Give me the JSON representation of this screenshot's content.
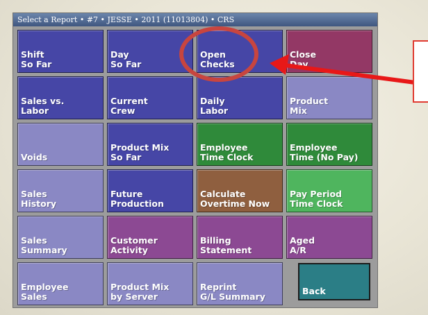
{
  "window": {
    "title": "Select a Report • #7 • JESSE • 2011 (11013804) • CRS"
  },
  "tiles": [
    {
      "line1": "Shift",
      "line2": "So Far",
      "color": "#4646a6"
    },
    {
      "line1": "Day",
      "line2": "So Far",
      "color": "#4646a6"
    },
    {
      "line1": "Open",
      "line2": "Checks",
      "color": "#4646a6"
    },
    {
      "line1": "Close",
      "line2": "Day",
      "color": "#933865"
    },
    {
      "line1": "Sales vs.",
      "line2": "Labor",
      "color": "#4646a6"
    },
    {
      "line1": "Current",
      "line2": "Crew",
      "color": "#4646a6"
    },
    {
      "line1": "Daily",
      "line2": "Labor",
      "color": "#4646a6"
    },
    {
      "line1": "Product",
      "line2": "Mix",
      "color": "#8a88c4"
    },
    {
      "line1": "",
      "line2": "Voids",
      "color": "#8a88c4"
    },
    {
      "line1": "Product Mix",
      "line2": "So Far",
      "color": "#4646a6"
    },
    {
      "line1": "Employee",
      "line2": "Time Clock",
      "color": "#2f8a3a"
    },
    {
      "line1": "Employee",
      "line2": "Time (No Pay)",
      "color": "#2f8a3a"
    },
    {
      "line1": "Sales",
      "line2": "History",
      "color": "#8a88c4"
    },
    {
      "line1": "Future",
      "line2": "Production",
      "color": "#4646a6"
    },
    {
      "line1": "Calculate",
      "line2": "Overtime Now",
      "color": "#8f5f3f"
    },
    {
      "line1": "Pay Period",
      "line2": "Time Clock",
      "color": "#4fb55e"
    },
    {
      "line1": "Sales",
      "line2": "Summary",
      "color": "#8a88c4"
    },
    {
      "line1": "Customer",
      "line2": "Activity",
      "color": "#8c4993"
    },
    {
      "line1": "Billing",
      "line2": "Statement",
      "color": "#8c4993"
    },
    {
      "line1": "Aged",
      "line2": "A/R",
      "color": "#8c4993"
    },
    {
      "line1": "Employee",
      "line2": "Sales",
      "color": "#8a88c4"
    },
    {
      "line1": "Product Mix",
      "line2": "by Server",
      "color": "#8a88c4"
    },
    {
      "line1": "Reprint",
      "line2": "G/L Summary",
      "color": "#8a88c4"
    }
  ],
  "back": {
    "label": "Back",
    "color": "#2b7e86"
  },
  "annotation": {
    "circle_color": "#c8453f",
    "arrow_color": "#e81818"
  }
}
